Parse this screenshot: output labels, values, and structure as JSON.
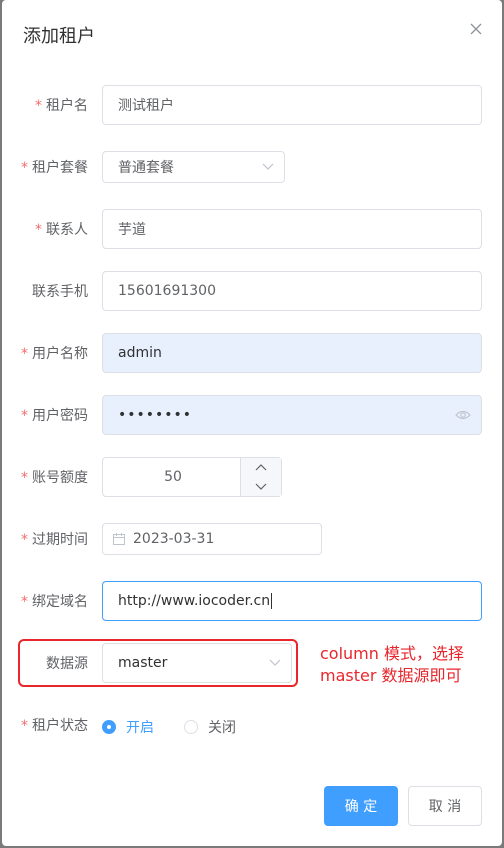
{
  "dialog": {
    "title": "添加租户",
    "close_label": "×"
  },
  "form": {
    "required_mark": "*",
    "tenant_name": {
      "label": "租户名",
      "value": "测试租户"
    },
    "package": {
      "label": "租户套餐",
      "value": "普通套餐"
    },
    "contact": {
      "label": "联系人",
      "value": "芋道"
    },
    "mobile": {
      "label": "联系手机",
      "value": "15601691300"
    },
    "username": {
      "label": "用户名称",
      "value": "admin"
    },
    "password": {
      "label": "用户密码",
      "value": "••••••••"
    },
    "account_count": {
      "label": "账号额度",
      "value": "50"
    },
    "expire_time": {
      "label": "过期时间",
      "value": "2023-03-31"
    },
    "domain": {
      "label": "绑定域名",
      "value": "http://www.iocoder.cn"
    },
    "datasource": {
      "label": "数据源",
      "value": "master"
    },
    "status": {
      "label": "租户状态",
      "options": [
        "开启",
        "关闭"
      ],
      "selected": "开启"
    }
  },
  "footer": {
    "confirm_label": "确 定",
    "cancel_label": "取 消"
  },
  "annotation": {
    "line1": "column 模式，选择",
    "line2": "master 数据源即可"
  },
  "colors": {
    "primary": "#409eff",
    "required": "#f56c6c",
    "annotation": "#e8262c",
    "autofill": "#e8f0fe"
  }
}
